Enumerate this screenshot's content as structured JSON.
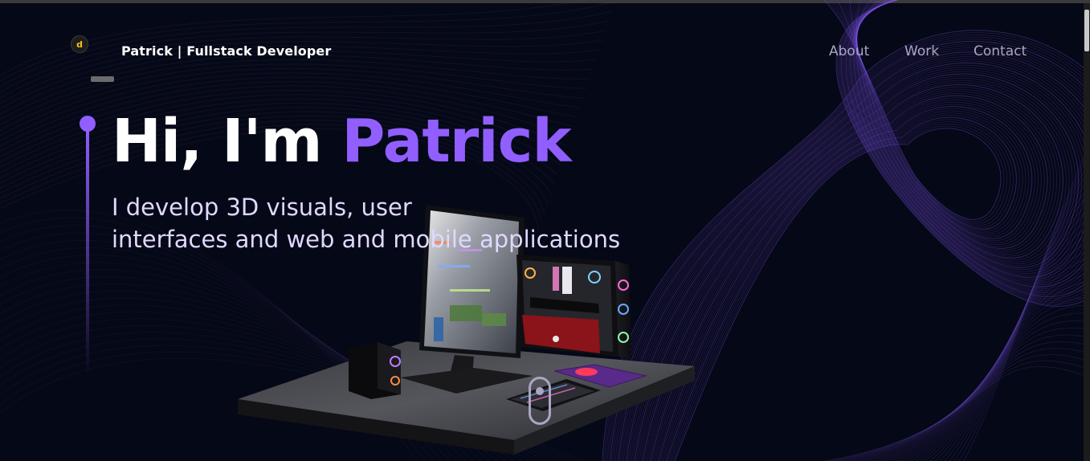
{
  "header": {
    "logo_glyph": "d",
    "brand": "Patrick  | Fullstack Developer",
    "nav": [
      "About",
      "Work",
      "Contact"
    ]
  },
  "hero": {
    "greeting": "Hi, I'm",
    "name": "Patrick",
    "subtitle_line1": "I develop 3D visuals, user",
    "subtitle_line2": "interfaces and web and mobile applications"
  },
  "colors": {
    "background": "#050816",
    "accent": "#915eff",
    "nav_text": "#aaa6c3",
    "subtitle_text": "#dfd9ff"
  },
  "icons": [
    "logo-icon",
    "scroll-indicator-icon"
  ]
}
